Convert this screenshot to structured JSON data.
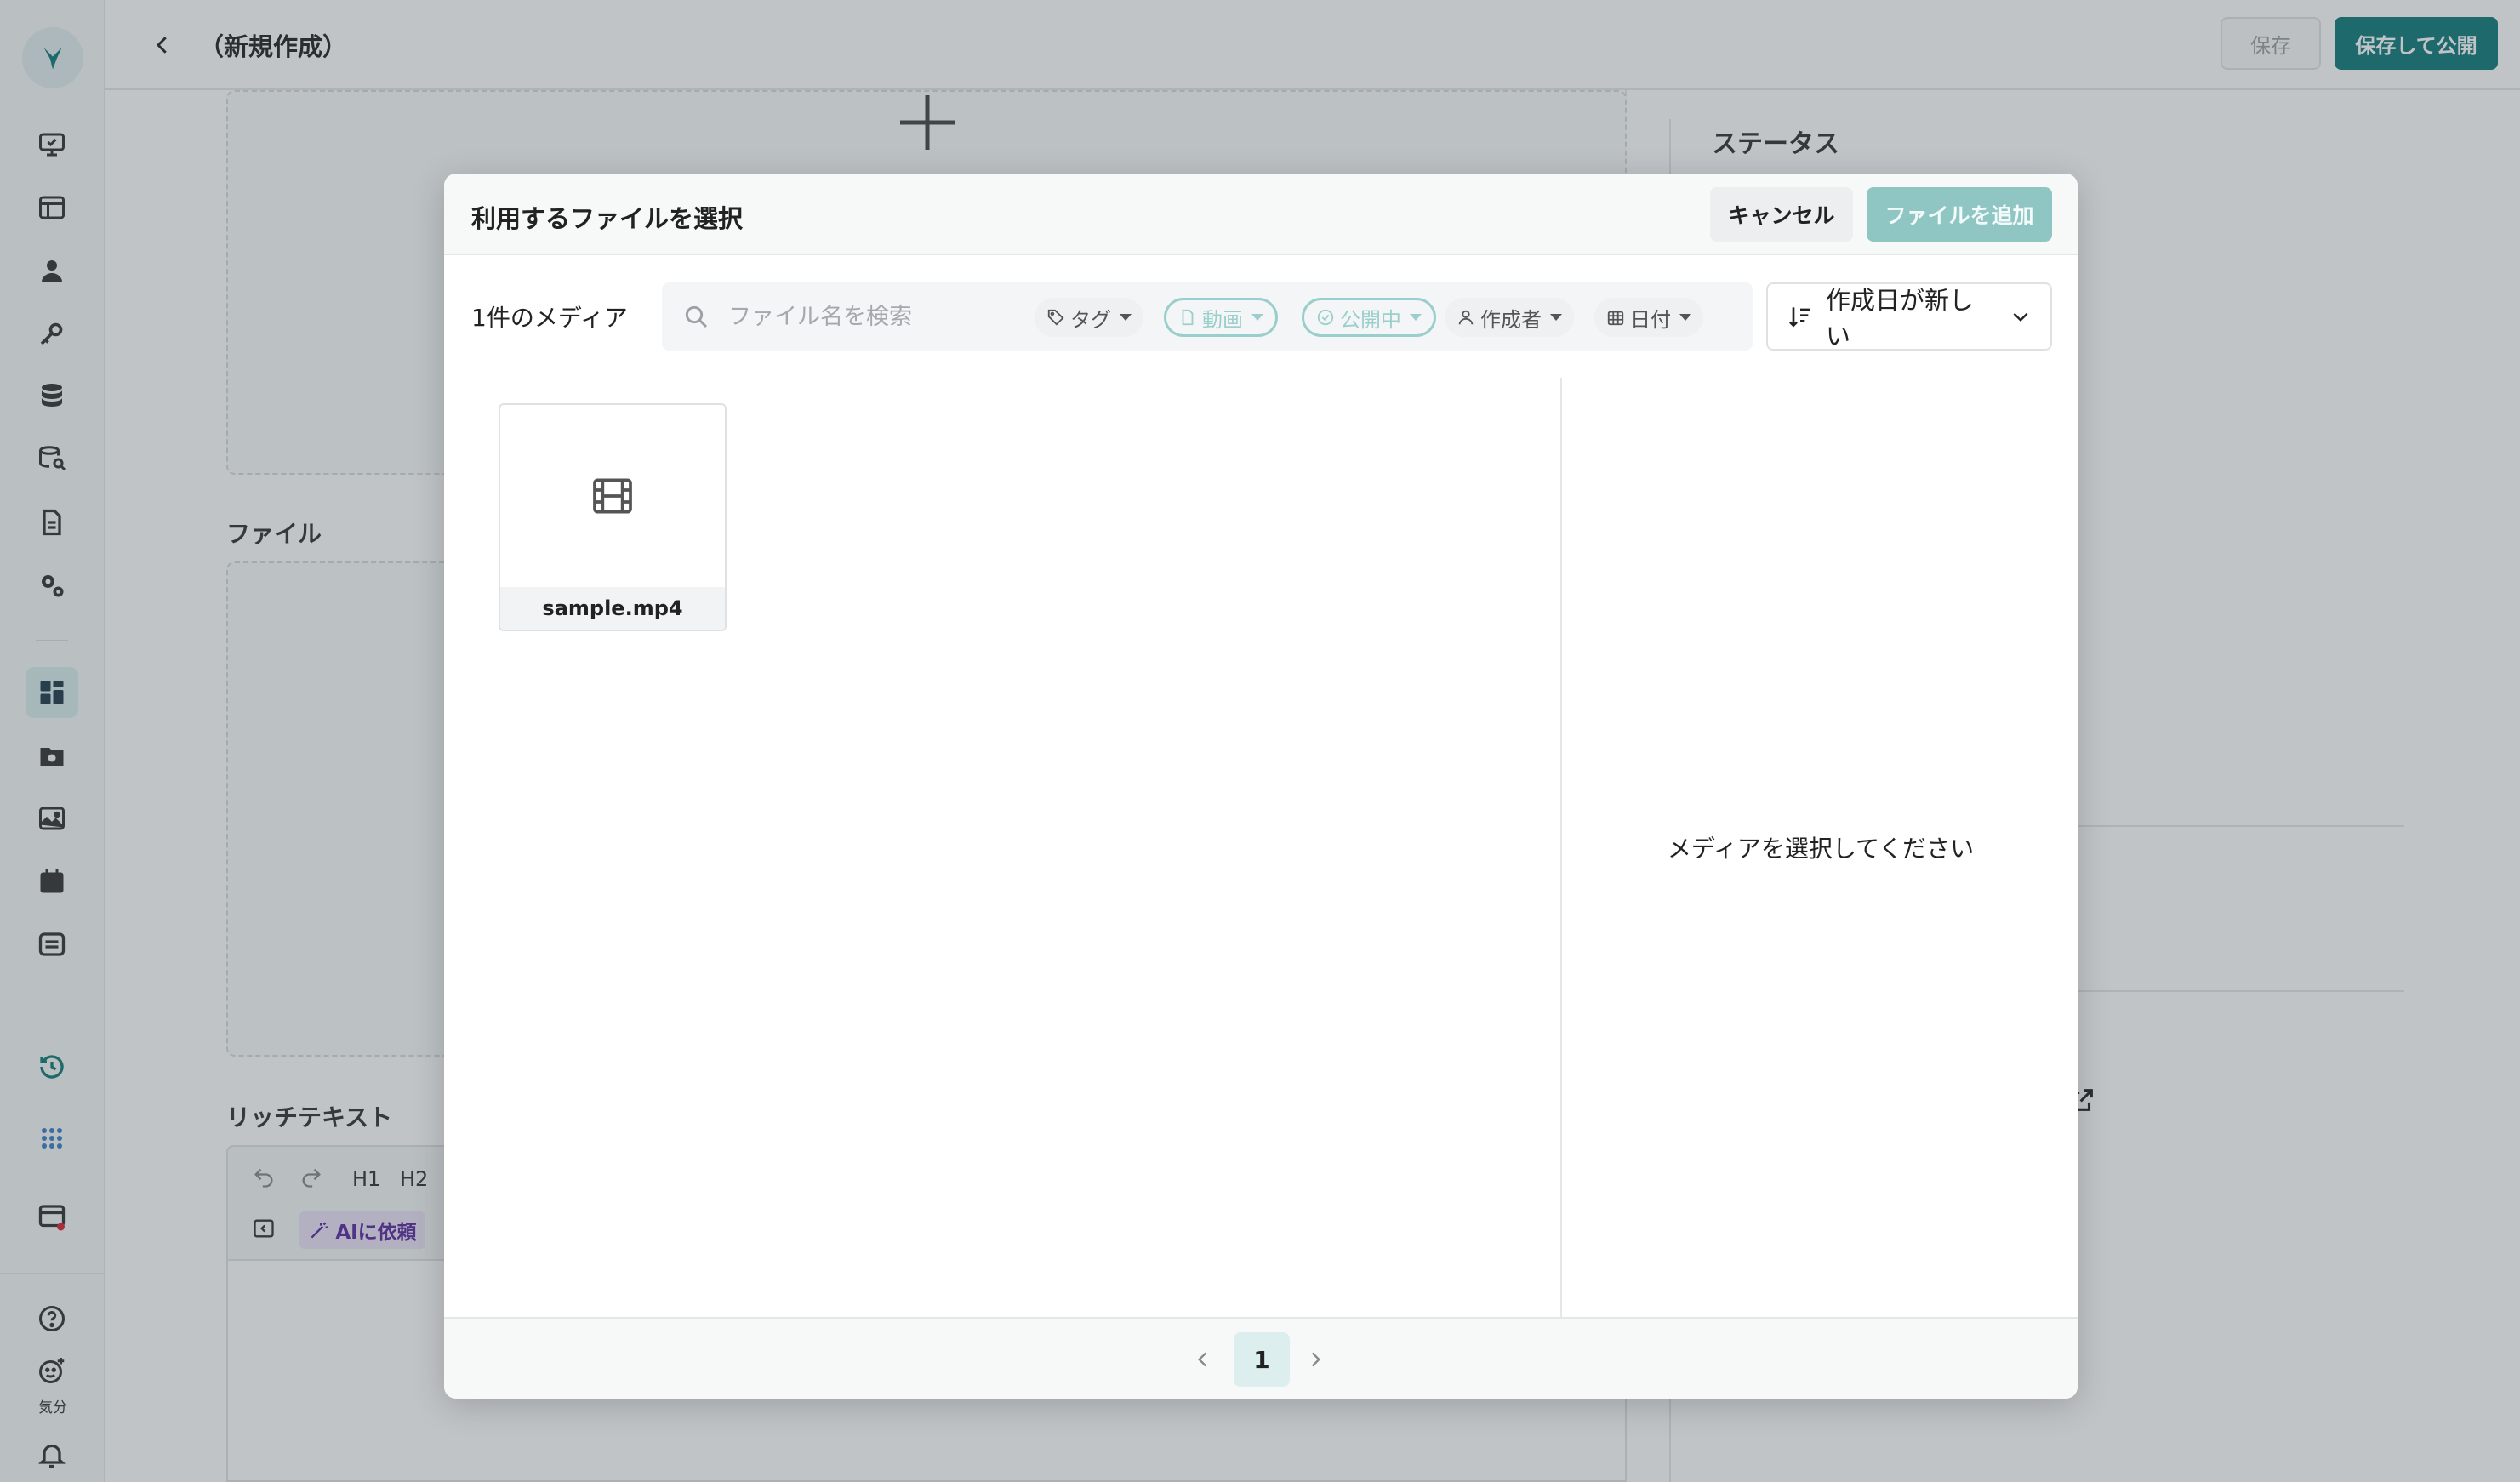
{
  "app": {
    "page_title": "（新規作成）",
    "save_label": "保存",
    "publish_label": "保存して公開",
    "accent_color": "#0f7a78"
  },
  "sidebar": {
    "icons": [
      "logo-icon",
      "monitor-icon",
      "layout-icon",
      "user-icon",
      "key-icon",
      "database-icon",
      "search-database-icon",
      "document-icon",
      "settings-icon",
      "dashboard-icon",
      "media-folder-icon",
      "image-icon",
      "calendar-icon",
      "list-icon",
      "history-icon",
      "apps-icon",
      "window-icon",
      "help-icon",
      "mood-icon",
      "bell-icon"
    ],
    "mood_label": "気分"
  },
  "form": {
    "file_label": "ファイル",
    "richtext_label": "リッチテキスト",
    "toolbar": {
      "h1": "H1",
      "h2": "H2",
      "ai_label": "AIに依頼"
    },
    "status_label": "ステータス"
  },
  "modal": {
    "title": "利用するファイルを選択",
    "cancel_label": "キャンセル",
    "add_label": "ファイルを追加",
    "media_count": "1件のメディア",
    "search": {
      "placeholder": "ファイル名を検索",
      "value": ""
    },
    "filters": [
      {
        "label": "タグ",
        "icon": "tag-icon",
        "active": false
      },
      {
        "label": "動画",
        "icon": "file-icon",
        "active": true
      },
      {
        "label": "公開中",
        "icon": "check-circle-icon",
        "active": true
      },
      {
        "label": "作成者",
        "icon": "person-icon",
        "active": false
      },
      {
        "label": "日付",
        "icon": "calendar-icon",
        "active": false
      }
    ],
    "sort": {
      "selected": "作成日が新しい",
      "icon": "sort-desc-icon"
    },
    "files": [
      {
        "name": "sample.mp4",
        "type": "video",
        "icon": "film-icon"
      }
    ],
    "detail_empty": "メディアを選択してください",
    "pagination": {
      "current": "1"
    }
  }
}
